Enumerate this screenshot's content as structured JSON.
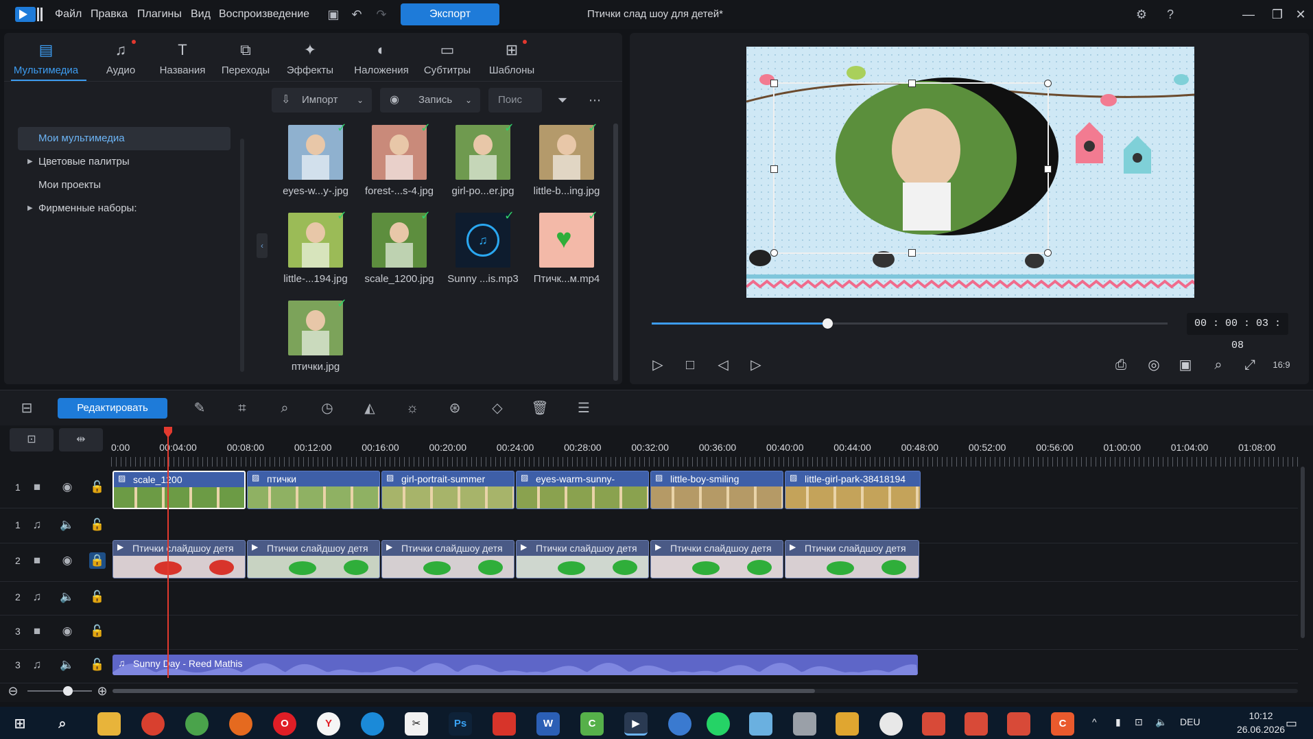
{
  "app": {
    "menu": [
      "Файл",
      "Правка",
      "Плагины",
      "Вид",
      "Воспроизведение"
    ],
    "export_label": "Экспорт",
    "doc_title": "Птички слад шоу для детей*"
  },
  "library": {
    "tabs": [
      {
        "label": "Мультимедиа",
        "icon": "media-icon"
      },
      {
        "label": "Аудио",
        "icon": "audio-icon"
      },
      {
        "label": "Названия",
        "icon": "titles-icon"
      },
      {
        "label": "Переходы",
        "icon": "transitions-icon"
      },
      {
        "label": "Эффекты",
        "icon": "effects-icon"
      },
      {
        "label": "Наложения",
        "icon": "overlays-icon"
      },
      {
        "label": "Субтитры",
        "icon": "subtitles-icon"
      },
      {
        "label": "Шаблоны",
        "icon": "templates-icon"
      }
    ],
    "tree": [
      {
        "label": "Мои мультимедиа",
        "expandable": false
      },
      {
        "label": "Цветовые палитры",
        "expandable": true
      },
      {
        "label": "Мои проекты",
        "expandable": false
      },
      {
        "label": "Фирменные наборы:",
        "expandable": true
      }
    ],
    "toolbar": {
      "import_label": "Импорт",
      "record_label": "Запись",
      "search_placeholder": "Поис"
    },
    "media": [
      {
        "name": "eyes-w...y-.jpg",
        "color": "#8fb1cf"
      },
      {
        "name": "forest-...s-4.jpg",
        "color": "#c98a7a"
      },
      {
        "name": "girl-po...er.jpg",
        "color": "#6f9a4f"
      },
      {
        "name": "little-b...ing.jpg",
        "color": "#b49a6b"
      },
      {
        "name": "little-...194.jpg",
        "color": "#9bbb57"
      },
      {
        "name": "scale_1200.jpg",
        "color": "#5d8e3e"
      },
      {
        "name": "Sunny ...is.mp3",
        "color": "#0e1c2e"
      },
      {
        "name": "Птичк...м.mp4",
        "color": "#f3b9a8"
      },
      {
        "name": "птички.jpg",
        "color": "#7ca35a"
      }
    ]
  },
  "preview": {
    "timecode": "00 : 00 : 03 : 08",
    "progress": 0.34
  },
  "edit_toolbar": {
    "edit_label": "Редактировать"
  },
  "timeline": {
    "ruler": [
      "0:00",
      "00:04:00",
      "00:08:00",
      "00:12:00",
      "00:16:00",
      "00:20:00",
      "00:24:00",
      "00:28:00",
      "00:32:00",
      "00:36:00",
      "00:40:00",
      "00:44:00",
      "00:48:00",
      "00:52:00",
      "00:56:00",
      "01:00:00",
      "01:04:00",
      "01:08:00"
    ],
    "tracks": [
      {
        "num": "1",
        "type": "video"
      },
      {
        "num": "1",
        "type": "audio"
      },
      {
        "num": "2",
        "type": "video"
      },
      {
        "num": "2",
        "type": "audio"
      },
      {
        "num": "3",
        "type": "video"
      },
      {
        "num": "3",
        "type": "audio"
      }
    ],
    "video_clips_1": [
      "scale_1200",
      "птички",
      "girl-portrait-summer",
      "eyes-warm-sunny-",
      "little-boy-smiling",
      "little-girl-park-38418194"
    ],
    "video_clips_2": [
      "Птички слайдшоу детя",
      "Птички слайдшоу детя",
      "Птички слайдшоу детя",
      "Птички слайдшоу детя",
      "Птички слайдшоу детя",
      "Птички слайдшоу детя"
    ],
    "audio_clip": "Sunny Day - Reed Mathis"
  },
  "taskbar": {
    "lang": "DEU",
    "time": "10:12",
    "date": "26.06.2026"
  }
}
